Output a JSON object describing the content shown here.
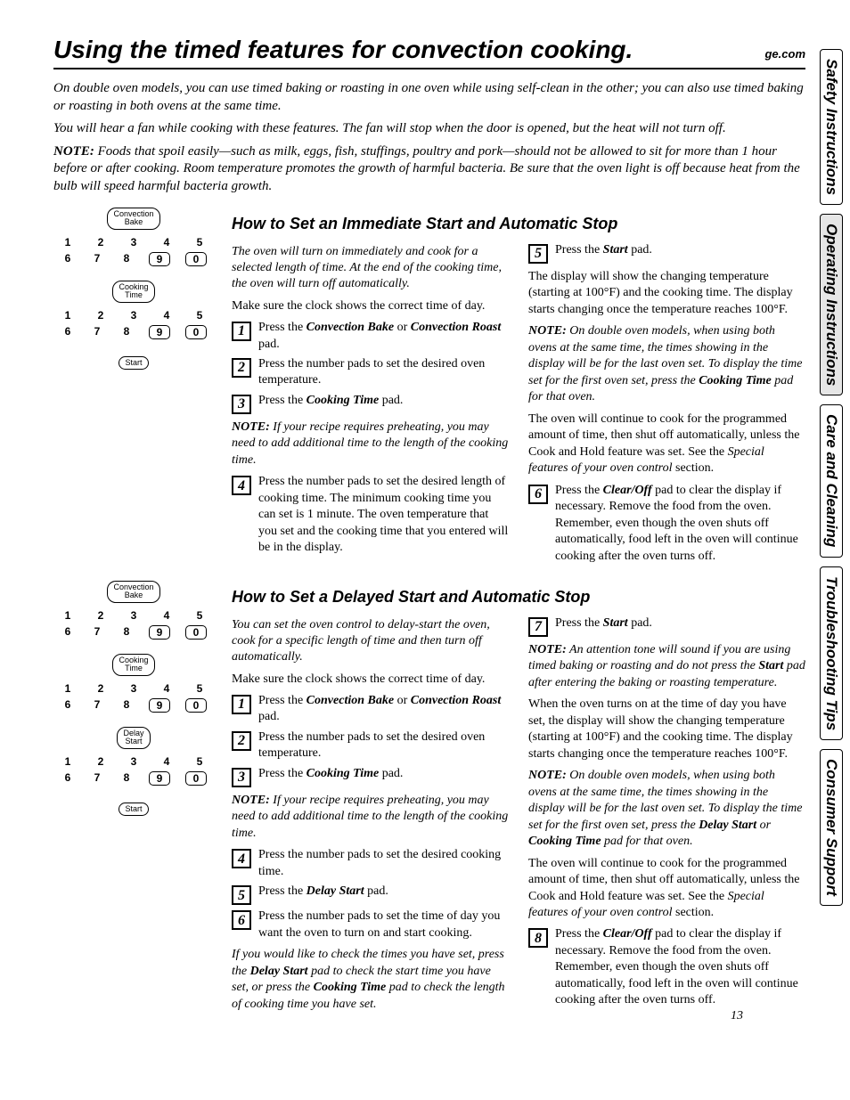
{
  "header": {
    "title": "Using the timed features for convection cooking.",
    "site": "ge.com"
  },
  "intro": {
    "p1": "On double oven models, you can use timed baking or roasting in one oven while using self-clean in the other; you can also use timed baking or roasting in both ovens at the same time.",
    "p2": "You will hear a fan while cooking with these features. The fan will stop when the door is opened, but the heat will not turn off.",
    "note_label": "NOTE:",
    "note": " Foods that spoil easily—such as milk, eggs, fish, stuffings, poultry and pork—should not be allowed to sit for more than 1 hour before or after cooking. Room temperature promotes the growth of harmful bacteria. Be sure that the oven light is off because heat from the bulb will speed harmful bacteria growth."
  },
  "panels": {
    "conv_bake": "Convection\nBake",
    "cooking_time": "Cooking\nTime",
    "delay_start": "Delay\nStart",
    "start": "Start",
    "row1": [
      "1",
      "2",
      "3",
      "4",
      "5"
    ],
    "row2": [
      "6",
      "7",
      "8",
      "9",
      "0"
    ]
  },
  "section1": {
    "heading": "How to Set an Immediate Start and Automatic Stop",
    "lead": "The oven will turn on immediately and cook for a selected length of time. At the end of the cooking time, the oven will turn off automatically.",
    "clock": "Make sure the clock shows the correct time of day.",
    "s1a": "Press the ",
    "s1b": "Convection Bake",
    "s1c": " or ",
    "s1d": "Convection Roast",
    "s1e": " pad.",
    "s2": "Press the number pads to set the desired oven temperature.",
    "s3a": "Press the ",
    "s3b": "Cooking Time",
    "s3c": " pad.",
    "note1_label": "NOTE:",
    "note1": " If your recipe requires preheating, you may need to add additional time to the length of the cooking time.",
    "s4": "Press the number pads to set the desired length of cooking time. The minimum cooking time you can set is 1 minute. The oven temperature that you set and the cooking time that you entered will be in the display.",
    "s5a": "Press the ",
    "s5b": "Start",
    "s5c": " pad.",
    "right1": "The display will show the changing temperature (starting at 100°F) and the cooking time. The display starts changing once the temperature reaches 100°F.",
    "note2_label": "NOTE:",
    "note2a": " On double oven models, when using both ovens at the same time, the times showing in the display will be for the last oven set. To display the time set for the first oven set, press the ",
    "note2b": "Cooking Time",
    "note2c": " pad for that oven.",
    "right2a": "The oven will continue to cook for the programmed amount of time, then shut off automatically, unless the Cook and Hold feature was set. See the ",
    "right2b": "Special features of your oven control",
    "right2c": " section.",
    "s6a": "Press the ",
    "s6b": "Clear/Off",
    "s6c": " pad to clear the display if necessary. Remove the food from the oven. Remember, even though the oven shuts off automatically, food left in the oven will continue cooking after the oven turns off."
  },
  "section2": {
    "heading": "How to Set a Delayed Start and Automatic Stop",
    "lead": "You can set the oven control to delay-start the oven, cook for a specific length of time and then turn off automatically.",
    "clock": "Make sure the clock shows the correct time of day.",
    "s1a": "Press the ",
    "s1b": "Convection Bake",
    "s1c": " or ",
    "s1d": "Convection Roast",
    "s1e": " pad.",
    "s2": "Press the number pads to set the desired oven temperature.",
    "s3a": "Press the ",
    "s3b": "Cooking Time",
    "s3c": " pad.",
    "note1_label": "NOTE:",
    "note1": " If your recipe requires preheating, you may need to add additional time to the length of the cooking time.",
    "s4": "Press the number pads to set the desired cooking time.",
    "s5a": "Press the ",
    "s5b": "Delay Start",
    "s5c": " pad.",
    "s6": "Press the number pads to set the time of day you want the oven to turn on and start cooking.",
    "check_a": "If you would like to check the times you have set, press the ",
    "check_b": "Delay Start",
    "check_c": " pad to check the start time you have set, or press the ",
    "check_d": "Cooking Time",
    "check_e": " pad to check the length of cooking time you have set.",
    "s7a": "Press the ",
    "s7b": "Start",
    "s7c": " pad.",
    "note2_label": "NOTE:",
    "note2a": " An attention tone will sound if you are using timed baking or roasting and do not press the ",
    "note2b": "Start",
    "note2c": " pad after entering the baking or roasting temperature.",
    "right1": "When the oven turns on at the time of day you have set, the display will show the changing temperature (starting at 100°F) and the cooking time. The display starts changing once the temperature reaches 100°F.",
    "note3_label": "NOTE:",
    "note3a": " On double oven models, when using both ovens at the same time, the times showing in the display will be for the last oven set. To display the time set for the first oven set, press the ",
    "note3b": "Delay Start",
    "note3c": " or ",
    "note3d": "Cooking Time",
    "note3e": " pad for that oven.",
    "right2a": "The oven will continue to cook for the programmed amount of time, then shut off automatically, unless the Cook and Hold feature was set. See the ",
    "right2b": "Special features of your oven control",
    "right2c": " section.",
    "s8a": "Press the ",
    "s8b": "Clear/Off",
    "s8c": " pad to clear the display if necessary. Remove the food from the oven. Remember, even though the oven shuts off automatically, food left in the oven will continue cooking after the oven turns off."
  },
  "tabs": {
    "t1": "Safety Instructions",
    "t2": "Operating Instructions",
    "t3": "Care and Cleaning",
    "t4": "Troubleshooting Tips",
    "t5": "Consumer Support"
  },
  "page": "13"
}
